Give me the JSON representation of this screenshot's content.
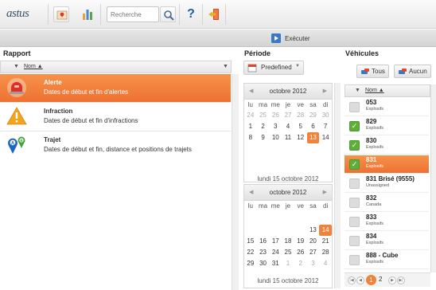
{
  "app": {
    "logo": "astus"
  },
  "toolbar": {
    "search_placeholder": "Recherche",
    "icons": [
      "map-icon",
      "chart-icon",
      "search-icon",
      "help-icon",
      "logout-icon"
    ],
    "help_label": "?"
  },
  "action": {
    "execute_label": "Exécuter"
  },
  "rapport": {
    "title": "Rapport",
    "column_header": "Nom ▲",
    "items": [
      {
        "title": "Alerte",
        "description": "Dates de début et fin d'alertes",
        "selected": true,
        "icon": "alert-siren-icon"
      },
      {
        "title": "Infraction",
        "description": "Dates de début et fin d'infractions",
        "selected": false,
        "icon": "warning-triangle-icon"
      },
      {
        "title": "Trajet",
        "description": "Dates de début et fin, distance et positions de trajets",
        "selected": false,
        "icon": "route-ab-icon"
      }
    ]
  },
  "periode": {
    "title": "Période",
    "predefined_label": "Predefined",
    "weekdays": [
      "lu",
      "ma",
      "me",
      "je",
      "ve",
      "sa",
      "di"
    ],
    "calendars": [
      {
        "month": "octobre 2012",
        "today": "lundi 15 octobre 2012",
        "days": [
          {
            "d": "24",
            "s": "o"
          },
          {
            "d": "25",
            "s": "o"
          },
          {
            "d": "26",
            "s": "o"
          },
          {
            "d": "27",
            "s": "o"
          },
          {
            "d": "28",
            "s": "o"
          },
          {
            "d": "29",
            "s": "o"
          },
          {
            "d": "30",
            "s": "o"
          },
          {
            "d": "1",
            "s": ""
          },
          {
            "d": "2",
            "s": ""
          },
          {
            "d": "3",
            "s": ""
          },
          {
            "d": "4",
            "s": ""
          },
          {
            "d": "5",
            "s": ""
          },
          {
            "d": "6",
            "s": ""
          },
          {
            "d": "7",
            "s": ""
          },
          {
            "d": "8",
            "s": ""
          },
          {
            "d": "9",
            "s": ""
          },
          {
            "d": "10",
            "s": ""
          },
          {
            "d": "11",
            "s": ""
          },
          {
            "d": "12",
            "s": ""
          },
          {
            "d": "13",
            "s": "s"
          },
          {
            "d": "14",
            "s": ""
          }
        ]
      },
      {
        "month": "octobre 2012",
        "today": "lundi 15 octobre 2012",
        "days": [
          {
            "d": "",
            "s": "x"
          },
          {
            "d": "",
            "s": "x"
          },
          {
            "d": "",
            "s": "x"
          },
          {
            "d": "",
            "s": "x"
          },
          {
            "d": "",
            "s": "x"
          },
          {
            "d": "13",
            "s": ""
          },
          {
            "d": "14",
            "s": "s"
          },
          {
            "d": "15",
            "s": ""
          },
          {
            "d": "16",
            "s": ""
          },
          {
            "d": "17",
            "s": ""
          },
          {
            "d": "18",
            "s": ""
          },
          {
            "d": "19",
            "s": ""
          },
          {
            "d": "20",
            "s": ""
          },
          {
            "d": "21",
            "s": ""
          },
          {
            "d": "22",
            "s": ""
          },
          {
            "d": "23",
            "s": ""
          },
          {
            "d": "24",
            "s": ""
          },
          {
            "d": "25",
            "s": ""
          },
          {
            "d": "26",
            "s": ""
          },
          {
            "d": "27",
            "s": ""
          },
          {
            "d": "28",
            "s": ""
          },
          {
            "d": "29",
            "s": ""
          },
          {
            "d": "30",
            "s": ""
          },
          {
            "d": "31",
            "s": ""
          },
          {
            "d": "1",
            "s": "o"
          },
          {
            "d": "2",
            "s": "o"
          },
          {
            "d": "3",
            "s": "o"
          },
          {
            "d": "4",
            "s": "o"
          }
        ]
      }
    ]
  },
  "vehicules": {
    "title": "Véhicules",
    "all_label": "Tous",
    "none_label": "Aucun",
    "column_header": "Nom ▲",
    "items": [
      {
        "name": "053",
        "group": "Explosifs",
        "checked": false,
        "selected": false
      },
      {
        "name": "829",
        "group": "Explosifs",
        "checked": true,
        "selected": false
      },
      {
        "name": "830",
        "group": "Explosifs",
        "checked": true,
        "selected": false
      },
      {
        "name": "831",
        "group": "Explosifs",
        "checked": true,
        "selected": true
      },
      {
        "name": "831 Brisé (9555)",
        "group": "Unassigned",
        "checked": false,
        "selected": false
      },
      {
        "name": "832",
        "group": "Canada",
        "checked": false,
        "selected": false
      },
      {
        "name": "833",
        "group": "Explosifs",
        "checked": false,
        "selected": false
      },
      {
        "name": "834",
        "group": "Explosifs",
        "checked": false,
        "selected": false
      },
      {
        "name": "888 - Cube",
        "group": "Explosifs",
        "checked": false,
        "selected": false
      }
    ],
    "pager": {
      "current": "1",
      "other": "2"
    }
  },
  "colors": {
    "accent": "#f0823c",
    "check": "#5fae3c",
    "logo": "#3a4f6a"
  }
}
